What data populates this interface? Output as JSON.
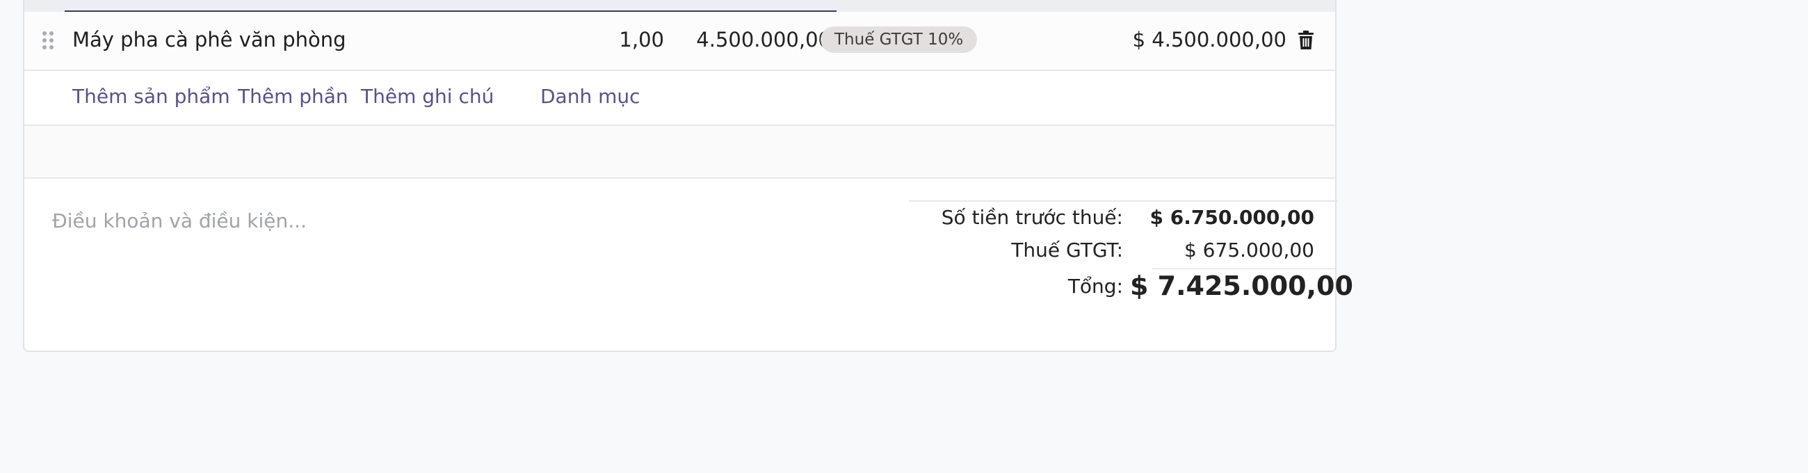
{
  "order_line": {
    "product_name": "Máy pha cà phê văn phòng",
    "quantity": "1,00",
    "unit_price": "4.500.000,00",
    "tax_badge": "Thuế GTGT 10%",
    "subtotal": "$ 4.500.000,00"
  },
  "actions": {
    "add_product": "Thêm sản phẩm",
    "add_section": "Thêm phần",
    "add_note": "Thêm ghi chú",
    "catalog": "Danh mục"
  },
  "terms": {
    "placeholder": "Điều khoản và điều kiện..."
  },
  "totals": {
    "untaxed_label": "Số tiền trước thuế:",
    "untaxed_value": "$ 6.750.000,00",
    "tax_label": "Thuế GTGT:",
    "tax_value": "$ 675.000,00",
    "total_label": "Tổng:",
    "total_value": "$ 7.425.000,00"
  },
  "colors": {
    "link": "#5b4f8f",
    "badge_bg": "#e4dfdf",
    "page_bg": "#f8f9fb"
  },
  "icons": {
    "drag": "drag-handle-icon",
    "delete": "trash-icon"
  }
}
